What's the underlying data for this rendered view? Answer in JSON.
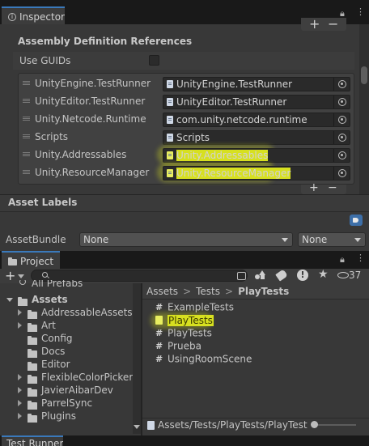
{
  "inspector": {
    "tab_label": "Inspector",
    "section_title": "Assembly Definition References",
    "use_guids_label": "Use GUIDs",
    "references": [
      {
        "name": "UnityEngine.TestRunner",
        "value": "UnityEngine.TestRunner",
        "highlight": false
      },
      {
        "name": "UnityEditor.TestRunner",
        "value": "UnityEditor.TestRunner",
        "highlight": false
      },
      {
        "name": "Unity.Netcode.Runtime",
        "value": "com.unity.netcode.runtime",
        "highlight": false
      },
      {
        "name": "Scripts",
        "value": "Scripts",
        "highlight": false
      },
      {
        "name": "Unity.Addressables",
        "value": "Unity.Addressables",
        "highlight": true
      },
      {
        "name": "Unity.ResourceManager",
        "value": "Unity.ResourceManager",
        "highlight": true
      }
    ],
    "add_symbol": "+",
    "remove_symbol": "−"
  },
  "asset_labels": {
    "title": "Asset Labels",
    "assetbundle_label": "AssetBundle",
    "bundle_value": "None",
    "variant_value": "None"
  },
  "project": {
    "tab_label": "Project",
    "add_symbol": "+",
    "hidden_count": "37",
    "tree": [
      {
        "label": "All Prefabs",
        "indent": 0,
        "expander": "none",
        "kind": "search"
      },
      {
        "label": "Assets",
        "indent": 0,
        "expander": "open",
        "kind": "folder",
        "bold": true
      },
      {
        "label": "AddressableAssetsD",
        "indent": 1,
        "expander": "closed",
        "kind": "folder"
      },
      {
        "label": "Art",
        "indent": 1,
        "expander": "closed",
        "kind": "folder"
      },
      {
        "label": "Config",
        "indent": 1,
        "expander": "none",
        "kind": "folder"
      },
      {
        "label": "Docs",
        "indent": 1,
        "expander": "none",
        "kind": "folder"
      },
      {
        "label": "Editor",
        "indent": 1,
        "expander": "none",
        "kind": "folder"
      },
      {
        "label": "FlexibleColorPicker",
        "indent": 1,
        "expander": "closed",
        "kind": "folder"
      },
      {
        "label": "JavierAibarDev",
        "indent": 1,
        "expander": "closed",
        "kind": "folder"
      },
      {
        "label": "ParrelSync",
        "indent": 1,
        "expander": "closed",
        "kind": "folder"
      },
      {
        "label": "Plugins",
        "indent": 1,
        "expander": "closed",
        "kind": "folder"
      }
    ],
    "breadcrumb": [
      "Assets",
      "Tests",
      "PlayTests"
    ],
    "breadcrumb_sep": ">",
    "files": [
      {
        "label": "ExampleTests",
        "kind": "script",
        "highlight": false
      },
      {
        "label": "PlayTests",
        "kind": "asmdef",
        "highlight": true
      },
      {
        "label": "PlayTests",
        "kind": "script",
        "highlight": false
      },
      {
        "label": "Prueba",
        "kind": "script",
        "highlight": false
      },
      {
        "label": "UsingRoomScene",
        "kind": "script",
        "highlight": false
      }
    ],
    "status_path": "Assets/Tests/PlayTests/PlayTest"
  },
  "bottom_tab": {
    "label": "Test Runner"
  },
  "colors": {
    "highlight": "#d7e020",
    "tab_accent": "#3a79bb",
    "panel": "#383838"
  }
}
